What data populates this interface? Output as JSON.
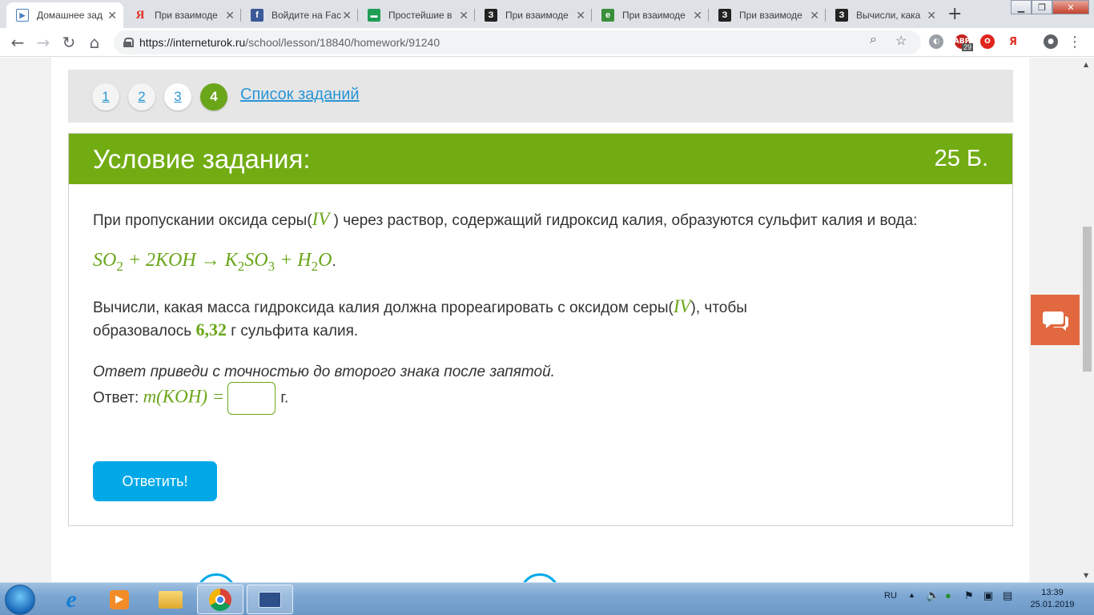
{
  "browser": {
    "tabs": [
      {
        "title": "Домашнее зад",
        "favicon": "play-icon",
        "active": true
      },
      {
        "title": "При взаимоде",
        "favicon": "yandex-icon"
      },
      {
        "title": "Войдите на Fac",
        "favicon": "facebook-icon"
      },
      {
        "title": "Простейшие в",
        "favicon": "book-icon"
      },
      {
        "title": "При взаимоде",
        "favicon": "z-icon"
      },
      {
        "title": "При взаимоде",
        "favicon": "e-icon"
      },
      {
        "title": "При взаимоде",
        "favicon": "z-icon"
      },
      {
        "title": "Вычисли, кака",
        "favicon": "z-icon"
      }
    ],
    "new_tab": "+",
    "url_host": "https://interneturok.ru",
    "url_path": "/school/lesson/18840/homework/91240",
    "ext_badge_count": "29"
  },
  "pager": {
    "items": [
      {
        "label": "1",
        "state": "done"
      },
      {
        "label": "2",
        "state": "done"
      },
      {
        "label": "3",
        "state": "normal"
      },
      {
        "label": "4",
        "state": "current"
      }
    ],
    "task_list_link": "Список заданий"
  },
  "task": {
    "title": "Условие задания:",
    "score": "25 Б.",
    "p1_before": "При пропускании оксида серы(",
    "oxid_state": "IV",
    "p1_after": ") через раствор, содержащий гидроксид калия, образуются сульфит калия и вода:",
    "equation": {
      "so": "SO",
      "so_sub": "2",
      "plus1": " + 2",
      "koh": "KOH",
      "arrow": " → ",
      "k": "K",
      "k_sub": "2",
      "so3": "SO",
      "so3_sub": "3",
      "plus2": " + ",
      "h": "H",
      "h_sub": "2",
      "o": "O",
      "end": "."
    },
    "p2_before": "Вычисли, какая масса гидроксида калия должна прореагировать с оксидом серы(",
    "p2_state": "IV",
    "p2_mid": "), чтобы образовалось",
    "mass_value": "6,32",
    "p2_after": "г сульфита калия.",
    "hint": "Ответ приведи с точностью до второго знака после запятой.",
    "answer_label": "Ответ:",
    "answer_formula": "m(KOH) =",
    "answer_unit": "г.",
    "submit_label": "Ответить!"
  },
  "colors": {
    "accent_green": "#72ac13",
    "link_blue": "#2a95d6",
    "button_blue": "#00a8e8",
    "chat_orange": "#e2683f"
  },
  "taskbar": {
    "lang": "RU",
    "time": "13:39",
    "date": "25.01.2019",
    "apps": [
      "ie-icon",
      "media-player-icon",
      "explorer-icon",
      "chrome-icon",
      "keyboard-icon"
    ]
  }
}
